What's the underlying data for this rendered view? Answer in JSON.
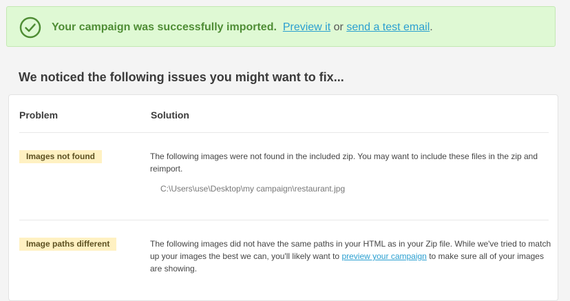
{
  "banner": {
    "message": "Your campaign was successfully imported.",
    "preview_link": "Preview it",
    "or_text": "or",
    "test_email_link": "send a test email",
    "period": ".",
    "icon": "check-circle-icon",
    "accent_color": "#4f8d35",
    "link_color": "#2a9fd0",
    "background_color": "#dff9d4"
  },
  "issues": {
    "heading": "We noticed the following issues you might want to fix...",
    "columns": {
      "problem": "Problem",
      "solution": "Solution"
    },
    "rows": [
      {
        "problem": "Images not found",
        "solution": "The following images were not found in the included zip. You may want to include these files in the zip and reimport.",
        "files": [
          "C:\\Users\\use\\Desktop\\my campaign\\restaurant.jpg"
        ]
      },
      {
        "problem": "Image paths different",
        "solution_before": "The following images did not have the same paths in your HTML as in your Zip file. While we've tried to match up your images the best we can, you'll likely want to",
        "solution_link": "preview your campaign",
        "solution_after": "to make sure all of your images are showing."
      }
    ]
  }
}
